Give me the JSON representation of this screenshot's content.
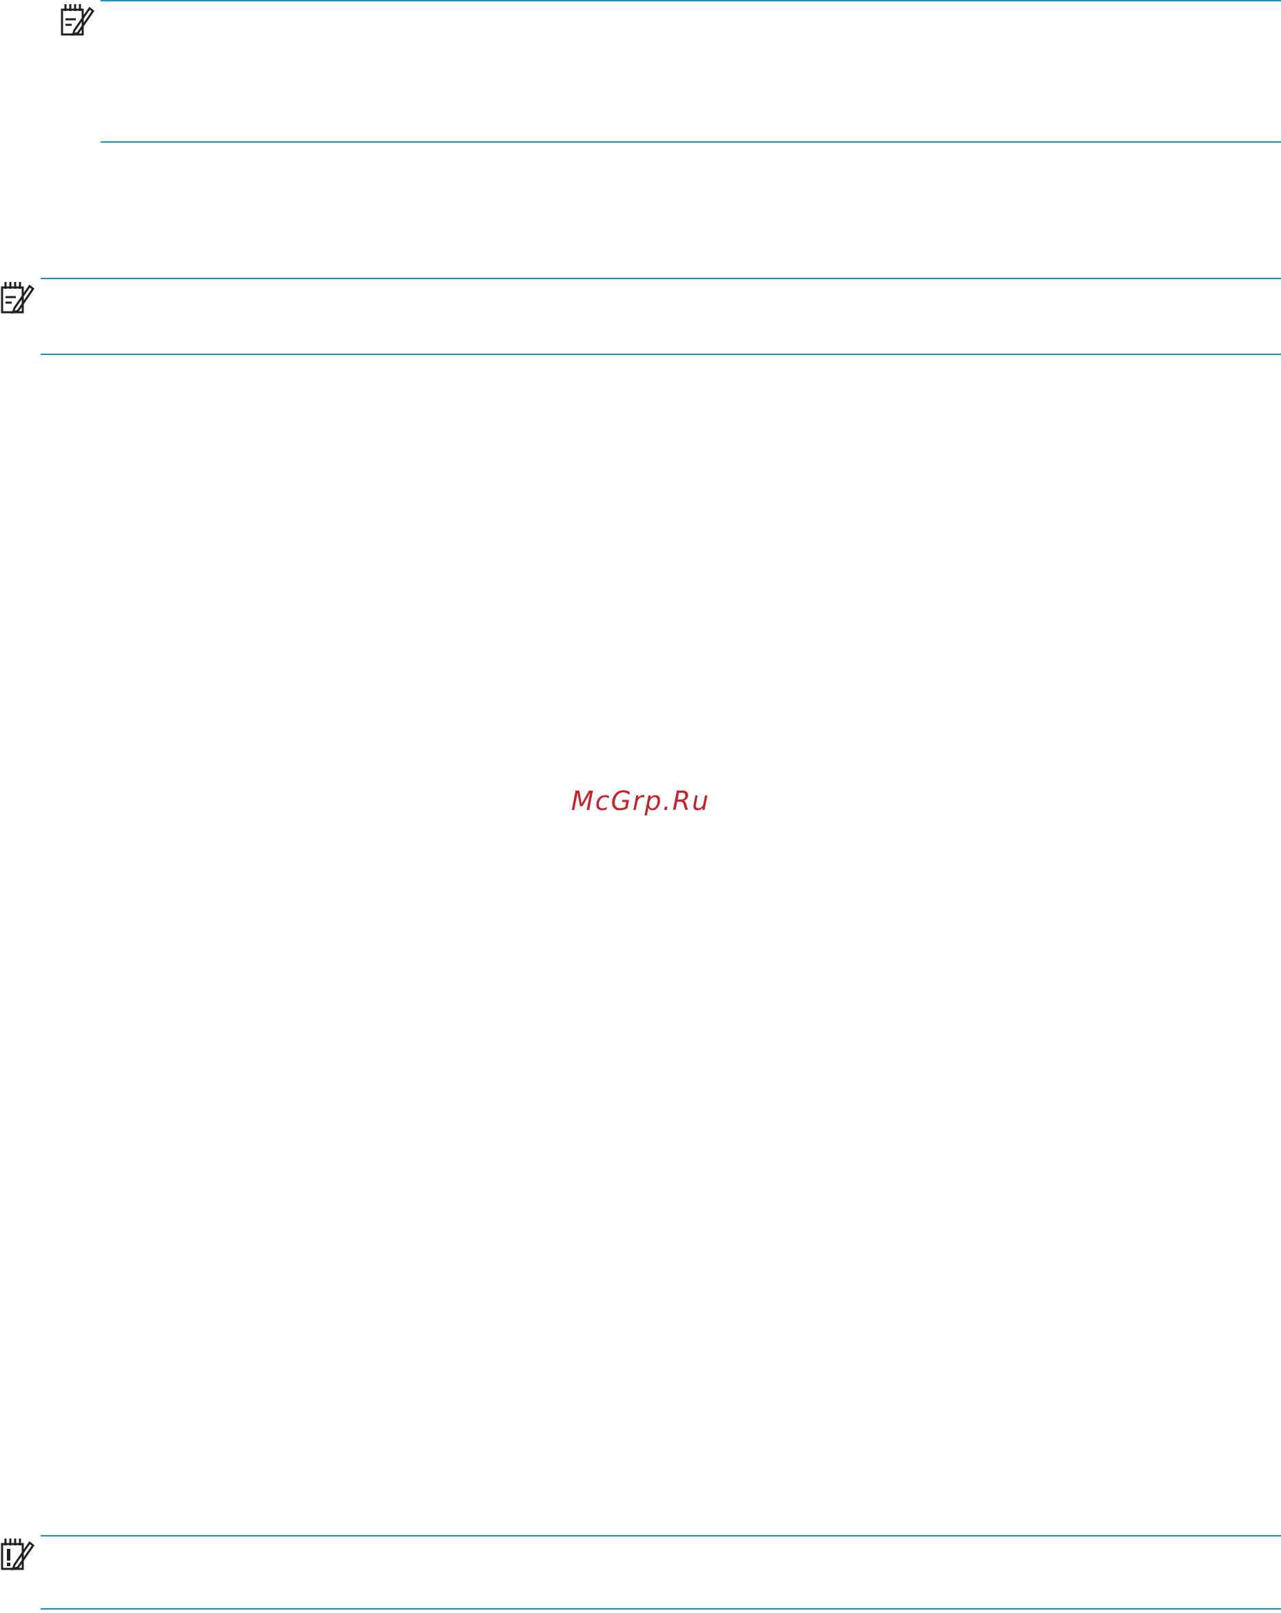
{
  "watermark": {
    "text": "McGrp.Ru",
    "color": "#c0272d"
  },
  "callouts": [
    {
      "kind": "note",
      "icon": "note-icon",
      "text": ""
    },
    {
      "kind": "note",
      "icon": "note-icon",
      "text": ""
    },
    {
      "kind": "important",
      "icon": "important-icon",
      "text": ""
    }
  ],
  "colors": {
    "rule": "#1a8fd0",
    "icon": "#231f20"
  }
}
